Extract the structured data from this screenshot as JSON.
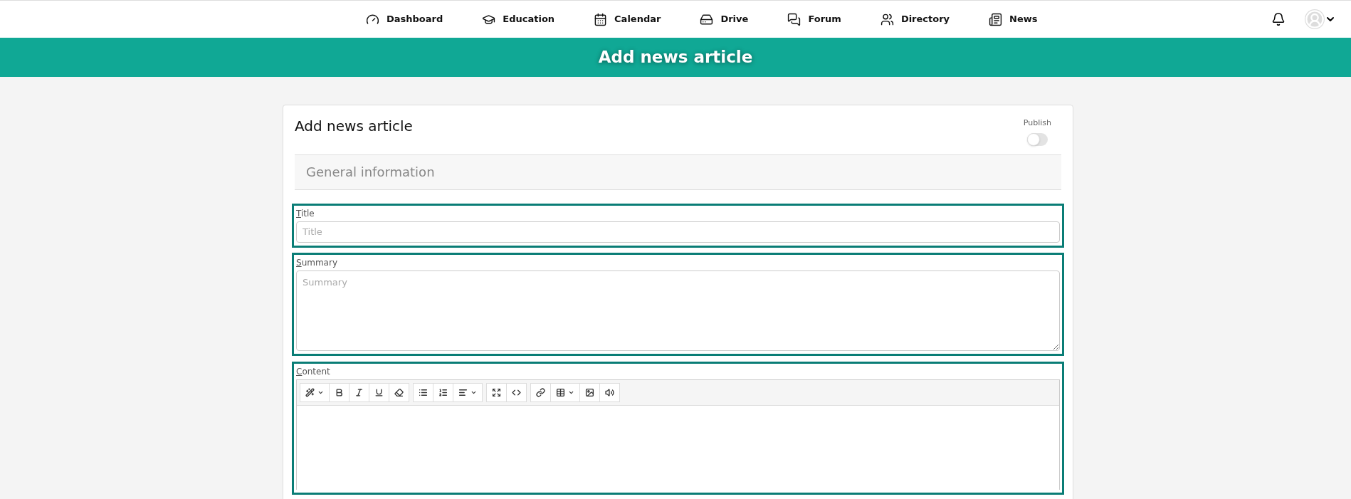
{
  "nav": {
    "items": [
      {
        "label": "Dashboard"
      },
      {
        "label": "Education"
      },
      {
        "label": "Calendar"
      },
      {
        "label": "Drive"
      },
      {
        "label": "Forum"
      },
      {
        "label": "Directory"
      },
      {
        "label": "News"
      }
    ]
  },
  "banner": {
    "title": "Add news article"
  },
  "card": {
    "title": "Add news article",
    "publish": {
      "label": "Publish",
      "on": false
    },
    "section": "General information",
    "fields": [
      {
        "kind": "input",
        "label": "Title",
        "placeholder": "Title"
      },
      {
        "kind": "textarea",
        "label": "Summary",
        "placeholder": "Summary"
      },
      {
        "kind": "editor",
        "label": "Content"
      }
    ]
  }
}
